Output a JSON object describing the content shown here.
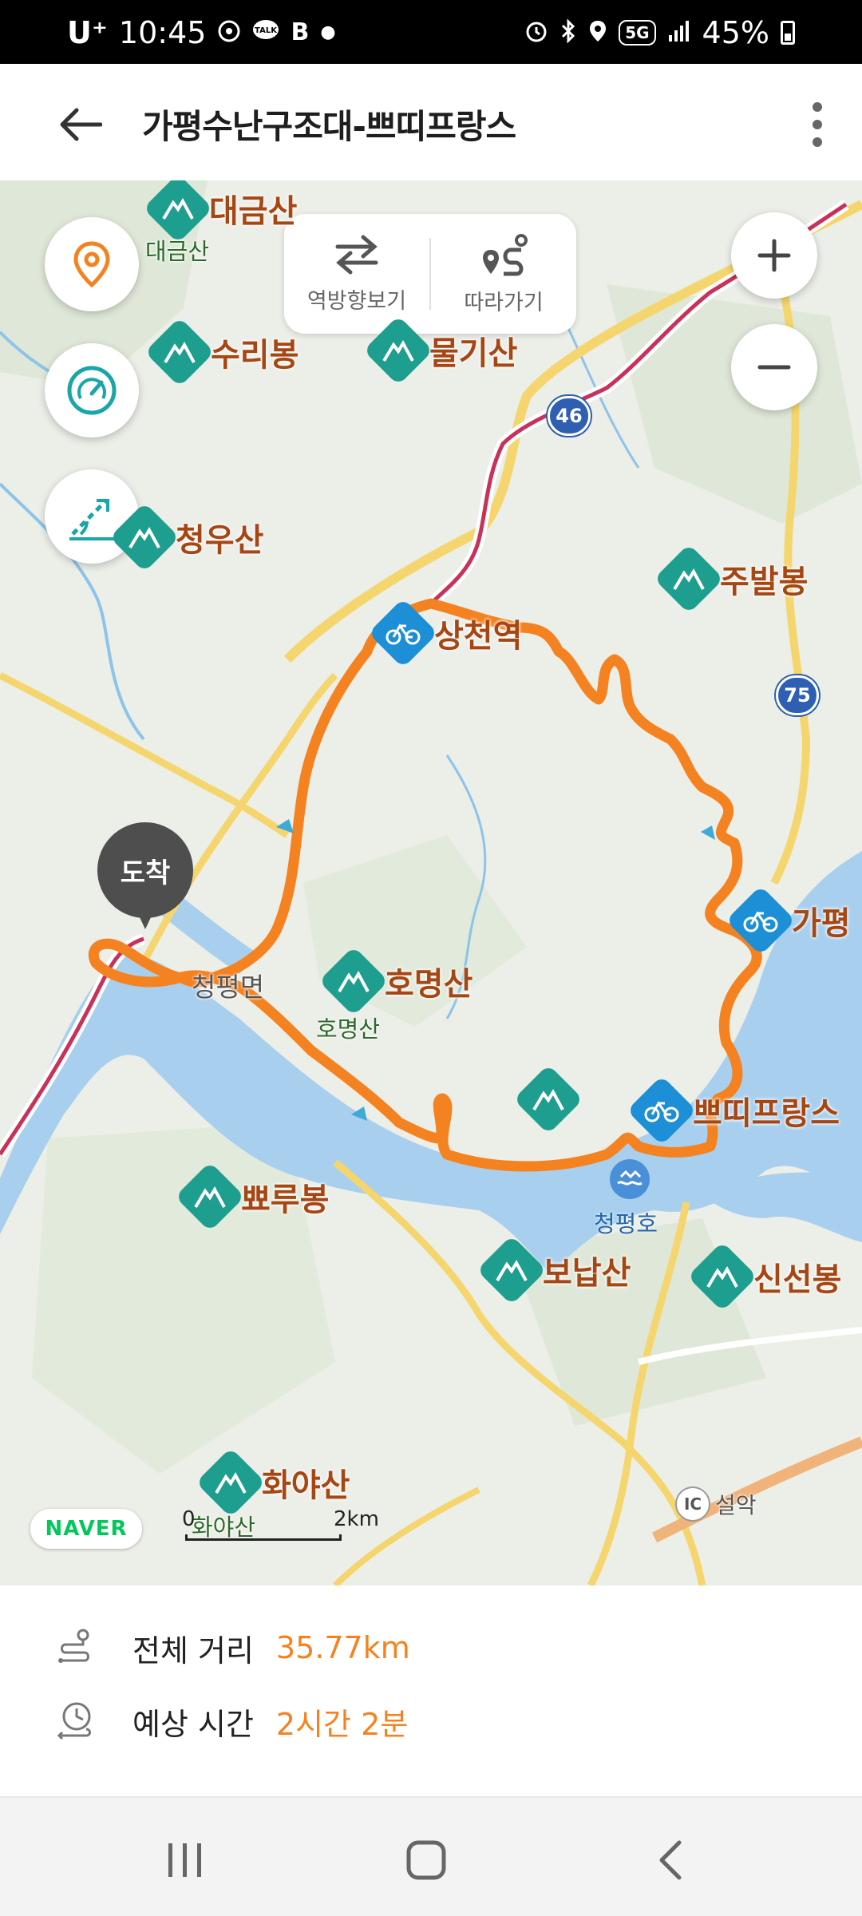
{
  "status_bar": {
    "carrier": "U⁺",
    "time": "10:45",
    "notif_icons": [
      "bike-app-icon",
      "kakaotalk-icon",
      "blog-icon"
    ],
    "network": "5G",
    "battery": "45%"
  },
  "header": {
    "title": "가평수난구조대-쁘띠프랑스",
    "back_icon": "arrow-left-icon",
    "menu_icon": "more-vertical-icon"
  },
  "map": {
    "toolbar": {
      "reverse_label": "역방향보기",
      "follow_label": "따라가기"
    },
    "places": {
      "daegeumsan": "대금산",
      "daegeumsan_sub": "대금산",
      "suribong": "수리봉",
      "mulgisan": "물기산",
      "cheongusan": "청우산",
      "jubalbong": "주발봉",
      "sangcheon_station": "상천역",
      "gapyeong": "가평",
      "homyeongsan": "호명산",
      "homyeongsan_sub": "호명산",
      "cheongpyeong": "청평면",
      "petite_france": "쁘띠프랑스",
      "ppyorubong": "뾰루봉",
      "cheongpyeong_lake": "청평호",
      "bonapsan": "보납산",
      "sinseonbong": "신선봉",
      "hwayasan": "화야산",
      "hwayasan_sub": "화야산",
      "ic_badge": "IC",
      "seorak": "설악"
    },
    "road_shields": {
      "r46": "46",
      "r75": "75"
    },
    "arrival_pin": "도착",
    "provider": "NAVER",
    "scale": {
      "zero": "0",
      "max": "2km"
    },
    "colors": {
      "route": "#f58220",
      "water": "#a8d0ee",
      "road": "#f5d66e",
      "mountain": "#1d9e8e",
      "bike": "#1c8fd6"
    }
  },
  "info": {
    "distance_label": "전체 거리",
    "distance_value": "35.77km",
    "time_label": "예상 시간",
    "time_value": "2시간 2분"
  },
  "nav_bar": {
    "recents_icon": "recents-icon",
    "home_icon": "home-icon",
    "back_icon": "back-icon"
  }
}
